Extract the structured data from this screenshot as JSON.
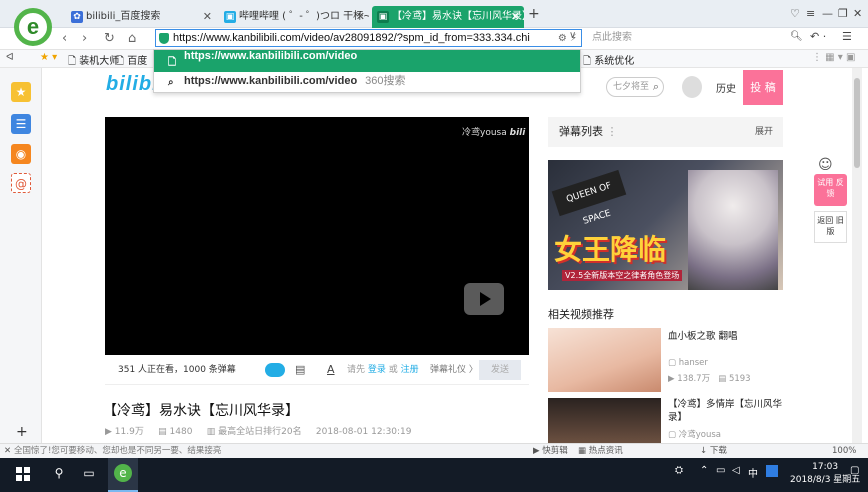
{
  "browser": {
    "tabs": [
      {
        "label": "bilibili_百度搜索",
        "active": false
      },
      {
        "label": "哔哩哔哩 ( ゜- ゜)つロ 干杯~-bili",
        "active": false
      },
      {
        "label": "【冷鸢】易水诀【忘川风华录】",
        "active": true
      }
    ],
    "url": "https://www.kanbilibili.com/video/av28091892/?spm_id_from=333.334.chi",
    "search_placeholder": "点此搜索",
    "suggestions": [
      {
        "text": "https://www.kanbilibili.com/video",
        "source": ""
      },
      {
        "text": "https://www.kanbilibili.com/video",
        "source": "360搜索"
      }
    ],
    "bookmarks": [
      "装机大师",
      "百度"
    ],
    "bookmark_right": "系统优化"
  },
  "site": {
    "logo": "bilibili",
    "search_placeholder": "七夕将至",
    "history_label": "历史",
    "upload_label": "投 稿",
    "feedback_label": "试用 反馈",
    "back_old_label": "返回 旧版"
  },
  "player": {
    "watermark": "冷鸢yousa",
    "viewers_text": "351 人正在看，1000 条弹幕",
    "login_prompt_prefix": "请先",
    "login_label": "登录",
    "login_or": "或",
    "register_label": "注册",
    "danmaku_etiquette": "弹幕礼仪 〉",
    "send_label": "发送"
  },
  "video": {
    "title": "【冷鸢】易水诀【忘川风华录】",
    "views": "11.9万",
    "danmaku_count": "1480",
    "rank": "最高全站日排行20名",
    "date": "2018-08-01 12:30:19"
  },
  "sidebar_right": {
    "danmaku_list_label": "弹幕列表",
    "expand_label": "展开",
    "banner_title": "女王降临",
    "banner_caption": "V2.5全新版本空之律者角色登场",
    "banner_badge": "QUEEN OF SPACE",
    "related_label": "相关视频推荐",
    "related": [
      {
        "title": "血小板之歌 翻唱",
        "author": "hanser",
        "views": "138.7万",
        "danmaku": "5193"
      },
      {
        "title": "【冷鸢】多情岸【忘川风华录】",
        "author": "冷鸢yousa",
        "views": "",
        "danmaku": ""
      }
    ]
  },
  "statusbar": {
    "message": "全国惊了!您可要移动、您却也是不同另一要、结果接亮",
    "items": [
      "快剪辑",
      "热点资讯",
      "下载",
      "中",
      "100%"
    ]
  },
  "taskbar": {
    "time": "17:03",
    "date": "2018/8/3 星期五",
    "ime": "中"
  }
}
